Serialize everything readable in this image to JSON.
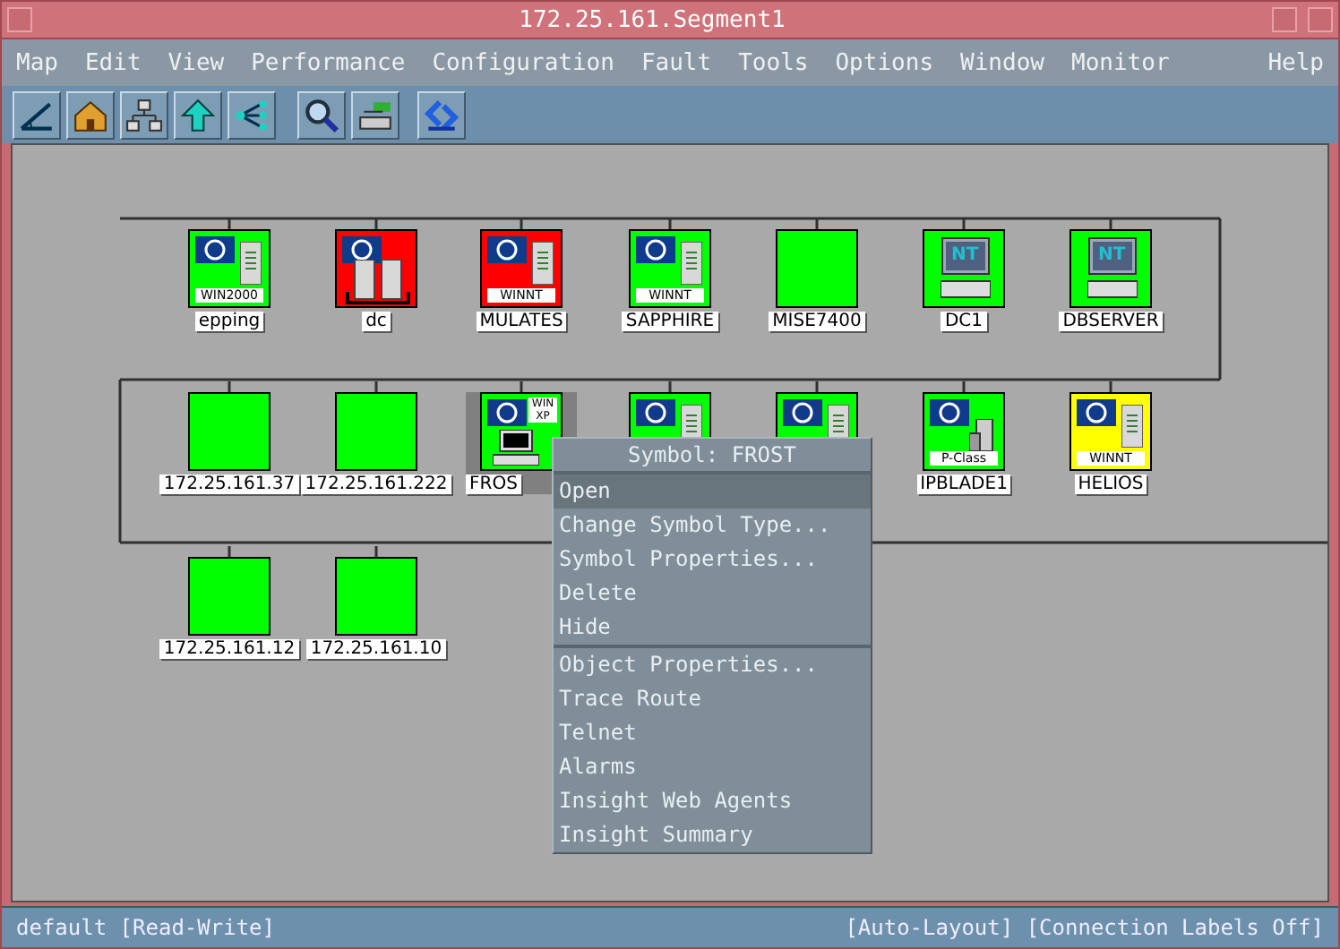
{
  "window": {
    "title": "172.25.161.Segment1"
  },
  "menu_bar": [
    "Map",
    "Edit",
    "View",
    "Performance",
    "Configuration",
    "Fault",
    "Tools",
    "Options",
    "Window",
    "Monitor",
    "Help"
  ],
  "toolbar": [
    {
      "kind": "ruler"
    },
    {
      "kind": "home"
    },
    {
      "kind": "network"
    },
    {
      "kind": "up"
    },
    {
      "kind": "branch"
    },
    {
      "kind": "search"
    },
    {
      "kind": "switch"
    },
    {
      "kind": "logo"
    }
  ],
  "map": {
    "nodes": [
      {
        "kind": "server",
        "color": "#00ff00",
        "badge": "WIN2000",
        "label": "epping",
        "selected": false
      },
      {
        "kind": "dual",
        "color": "#ff0000",
        "label": "dc",
        "selected": false
      },
      {
        "kind": "server",
        "color": "#ff0000",
        "badge": "WINNT",
        "label": "MULATES",
        "selected": false
      },
      {
        "kind": "server",
        "color": "#00ff00",
        "badge": "WINNT",
        "label": "SAPPHIRE",
        "selected": false
      },
      {
        "kind": "blank",
        "color": "#00ff00",
        "label": "MISE7400",
        "selected": false
      },
      {
        "kind": "nt",
        "color": "#00ff00",
        "badge": "NT",
        "label": "DC1",
        "selected": false
      },
      {
        "kind": "nt",
        "color": "#00ff00",
        "badge": "NT",
        "label": "DBSERVER",
        "selected": false
      },
      {
        "kind": "blank",
        "color": "#00ff00",
        "label": "172.25.161.37",
        "selected": false
      },
      {
        "kind": "blank",
        "color": "#00ff00",
        "label": "172.25.161.222",
        "selected": false
      },
      {
        "kind": "pc",
        "color": "#00ff00",
        "badge": "WIN XP",
        "label": "FROS",
        "selected": true
      },
      {
        "kind": "server",
        "color": "#00ff00",
        "selected": false
      },
      {
        "kind": "server",
        "color": "#00ff00",
        "selected": false
      },
      {
        "kind": "blade",
        "color": "#00ff00",
        "badge": "P-Class",
        "label": "IPBLADE1",
        "selected": false
      },
      {
        "kind": "server",
        "color": "#ffff00",
        "badge": "WINNT",
        "label": "HELIOS",
        "selected": false
      },
      {
        "kind": "blank",
        "color": "#00ff00",
        "label": "172.25.161.12",
        "selected": false
      },
      {
        "kind": "blank",
        "color": "#00ff00",
        "label": "172.25.161.10",
        "selected": false
      }
    ]
  },
  "context_menu": {
    "title": "Symbol: FROST",
    "sections": [
      [
        {
          "label": "Open",
          "selected": true
        },
        {
          "label": "Change Symbol Type...",
          "selected": false
        },
        {
          "label": "Symbol Properties...",
          "selected": false
        },
        {
          "label": "Delete",
          "selected": false
        },
        {
          "label": "Hide",
          "selected": false
        }
      ],
      [
        {
          "label": "Object Properties...",
          "selected": false
        },
        {
          "label": "Trace Route",
          "selected": false
        },
        {
          "label": "Telnet",
          "selected": false
        },
        {
          "label": "Alarms",
          "selected": false
        },
        {
          "label": "Insight Web Agents",
          "selected": false
        },
        {
          "label": "Insight Summary",
          "selected": false
        }
      ]
    ]
  },
  "status_bar": {
    "left": "default [Read-Write]",
    "right": "[Auto-Layout] [Connection Labels Off]"
  }
}
